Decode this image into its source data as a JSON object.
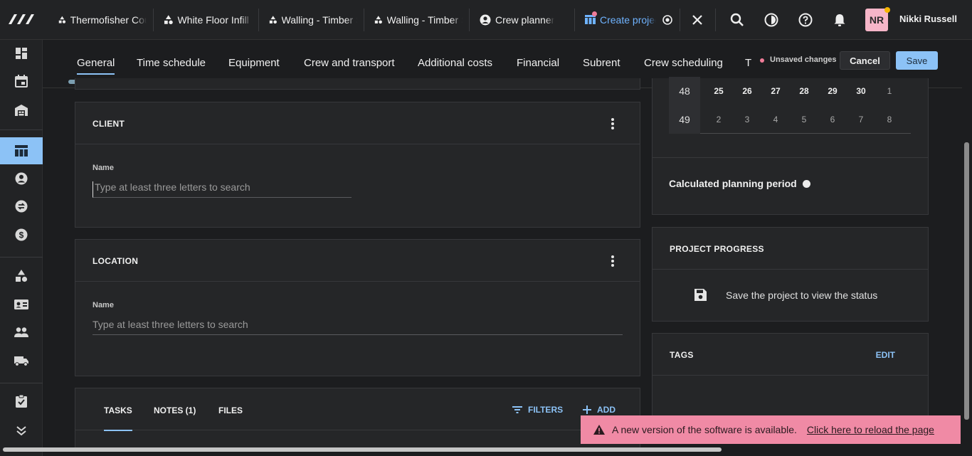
{
  "workspace_tabs": [
    {
      "label": "Thermofisher Coupling",
      "icon": "shapes-icon"
    },
    {
      "label": "White Floor Infill (",
      "icon": "shapes-icon"
    },
    {
      "label": "Walling - Timber Sub",
      "icon": "shapes-icon"
    },
    {
      "label": "Walling - Timber Sub",
      "icon": "shapes-icon"
    },
    {
      "label": "Crew planner",
      "icon": "person-circle-icon"
    },
    {
      "label": "Create project",
      "icon": "table-icon"
    }
  ],
  "user": {
    "initials": "NR",
    "name": "Nikki Russell"
  },
  "section_tabs": [
    "General",
    "Time schedule",
    "Equipment",
    "Crew and transport",
    "Additional costs",
    "Financial",
    "Subrent",
    "Crew scheduling",
    "T"
  ],
  "header": {
    "unsaved": "Unsaved changes",
    "cancel": "Cancel",
    "save": "Save"
  },
  "client": {
    "title": "CLIENT",
    "name_label": "Name",
    "name_placeholder": "Type at least three letters to search"
  },
  "location": {
    "title": "LOCATION",
    "name_label": "Name",
    "name_placeholder": "Type at least three letters to search"
  },
  "bottom_tabs": {
    "tasks": "TASKS",
    "notes": "NOTES (1)",
    "files": "FILES",
    "filters": "FILTERS",
    "add": "ADD"
  },
  "calendar": {
    "rows": [
      {
        "week": "48",
        "days": [
          "25",
          "26",
          "27",
          "28",
          "29",
          "30",
          "1"
        ]
      },
      {
        "week": "49",
        "days": [
          "2",
          "3",
          "4",
          "5",
          "6",
          "7",
          "8"
        ]
      }
    ]
  },
  "planning": {
    "label": "Calculated planning period"
  },
  "progress": {
    "title": "PROJECT PROGRESS",
    "message": "Save the project to view the status"
  },
  "tags": {
    "title": "TAGS",
    "edit": "EDIT"
  },
  "toast": {
    "message": "A new version of the software is available.",
    "link": "Click here to reload the page"
  },
  "colors": {
    "accent": "#8cc2f6",
    "toast": "#f08aa5",
    "avatar": "#f6b5c8"
  }
}
